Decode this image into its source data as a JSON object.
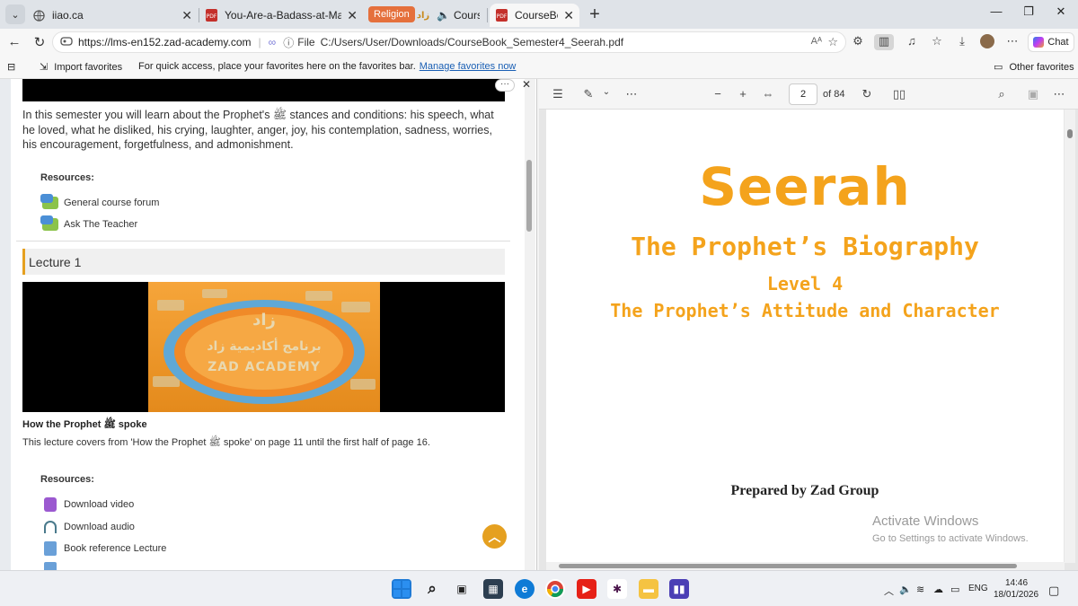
{
  "tabs": [
    {
      "title": "iiao.ca",
      "icon": "globe-icon"
    },
    {
      "title": "You-Are-a-Badass-at-Making-Mon",
      "icon": "pdf-icon"
    },
    {
      "title": "Course:",
      "icon": "course-icon",
      "audio": true
    },
    {
      "title": "CourseBook",
      "icon": "pdf-icon",
      "active": true
    }
  ],
  "tab_group_label": "Religion",
  "address": {
    "url": "https://lms-en152.zad-academy.com",
    "file_label": "File",
    "path": "C:/Users/User/Downloads/CourseBook_Semester4_Seerah.pdf"
  },
  "chat_label": "Chat",
  "favorites": {
    "import_label": "Import favorites",
    "hint": "For quick access, place your favorites here on the favorites bar.",
    "manage_link": "Manage favorites now",
    "other_label": "Other favorites"
  },
  "course": {
    "intro": "In this semester you will learn about the Prophet's ﷺ stances and conditions: his speech, what he loved, what he disliked, his crying, laughter, anger, joy, his contemplation, sadness, worries, his encouragement, forgetfulness, and admonishment.",
    "resources_heading": "Resources:",
    "resources": [
      "General course forum",
      "Ask The Teacher"
    ],
    "lecture_header": "Lecture 1",
    "video_logo_text": "ZAD ACADEMY",
    "lecture_title": "How the Prophet ﷺ spoke",
    "lecture_desc": "This lecture covers from 'How the Prophet ﷺ spoke' on page 11 until the first half of page 16.",
    "lecture_resources_heading": "Resources:",
    "lecture_resources": [
      "Download video",
      "Download audio",
      "Book reference Lecture"
    ]
  },
  "pdf": {
    "page_number": "2",
    "page_total": "of 84",
    "title": "Seerah",
    "subtitle": "The Prophet’s Biography",
    "level": "Level 4",
    "topic": "The Prophet’s Attitude and Character",
    "prepared_by": "Prepared by Zad Group",
    "accent_color": "#f4a31c"
  },
  "watermark": {
    "line1": "Activate Windows",
    "line2": "Go to Settings to activate Windows."
  },
  "system_tray": {
    "language": "ENG",
    "time": "14:46",
    "date": "18/01/2026"
  },
  "colors": {
    "tab_group": "#e5703c",
    "scroll_top_button": "#e5a020"
  }
}
